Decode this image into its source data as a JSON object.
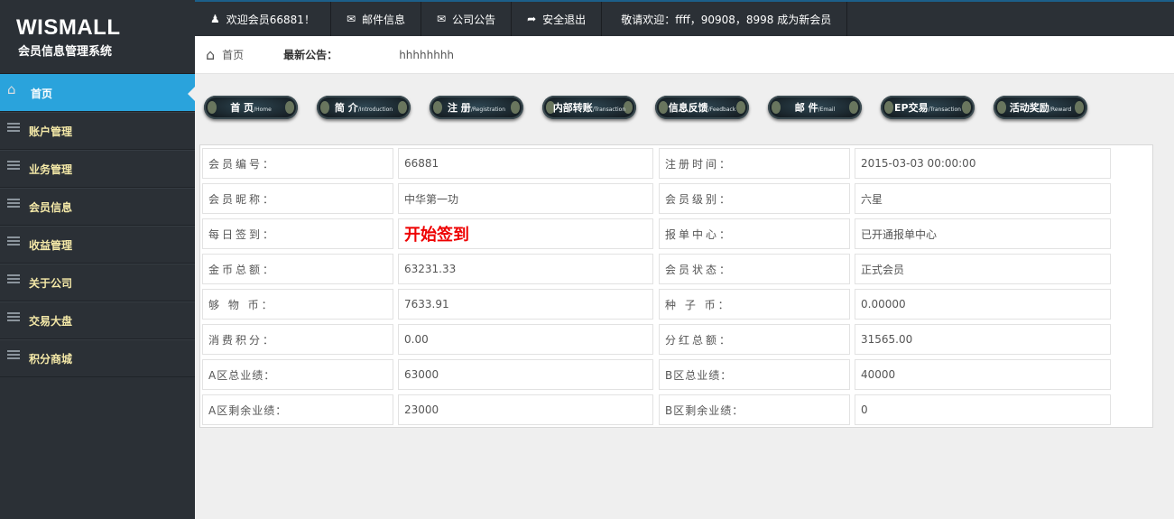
{
  "brand": {
    "title": "WISMALL",
    "subtitle": "会员信息管理系统"
  },
  "sidebar": {
    "items": [
      {
        "label": "首页",
        "icon": "home-icon",
        "active": true
      },
      {
        "label": "账户管理",
        "icon": "menu-icon"
      },
      {
        "label": "业务管理",
        "icon": "menu-icon"
      },
      {
        "label": "会员信息",
        "icon": "menu-icon"
      },
      {
        "label": "收益管理",
        "icon": "menu-icon"
      },
      {
        "label": "关于公司",
        "icon": "menu-icon"
      },
      {
        "label": "交易大盘",
        "icon": "menu-icon"
      },
      {
        "label": "积分商城",
        "icon": "menu-icon"
      }
    ]
  },
  "topbar": {
    "user": "欢迎会员66881！",
    "mail": "邮件信息",
    "notice": "公司公告",
    "logout": "安全退出",
    "welcome": "敬请欢迎：ffff，90908，8998 成为新会员"
  },
  "breadcrumb": {
    "home": "首页",
    "announcement_label": "最新公告：",
    "announcement_value": "hhhhhhhh"
  },
  "nav_buttons": [
    {
      "cn": "首 页",
      "en": "/Home"
    },
    {
      "cn": "简 介",
      "en": "/Introduction"
    },
    {
      "cn": "注 册",
      "en": "/Registration"
    },
    {
      "cn": "内部转账",
      "en": "/Transaction"
    },
    {
      "cn": "信息反馈",
      "en": "/Feedback"
    },
    {
      "cn": "邮 件",
      "en": "/Email"
    },
    {
      "cn": "EP交易",
      "en": "/Transaction"
    },
    {
      "cn": "活动奖励",
      "en": "/Reward"
    }
  ],
  "info": {
    "rows": [
      {
        "l1": "会员编号：",
        "v1": "66881",
        "l2": "注册时间：",
        "v2": "2015-03-03 00:00:00"
      },
      {
        "l1": "会员昵称：",
        "v1": "中华第一功",
        "l2": "会员级别：",
        "v2": "六星"
      },
      {
        "l1": "每日签到：",
        "v1": "开始签到",
        "l2": "报单中心：",
        "v2": "已开通报单中心"
      },
      {
        "l1": "金币总额：",
        "v1": "63231.33",
        "l2": "会员状态：",
        "v2": "正式会员"
      },
      {
        "l1": "够 物 币：",
        "v1": "7633.91",
        "l2": "种 子 币：",
        "v2": "0.00000"
      },
      {
        "l1": "消费积分：",
        "v1": "0.00",
        "l2": "分红总额：",
        "v2": "31565.00"
      },
      {
        "l1": "A区总业绩：",
        "v1": "63000",
        "l2": "B区总业绩：",
        "v2": "40000"
      },
      {
        "l1": "A区剩余业绩：",
        "v1": "23000",
        "l2": "B区剩余业绩：",
        "v2": "0"
      }
    ]
  },
  "colors": {
    "sidebar_bg": "#2b3036",
    "active": "#2aa3dc",
    "menu_text": "#f5e9a8",
    "sign_in": "#ee0000"
  }
}
